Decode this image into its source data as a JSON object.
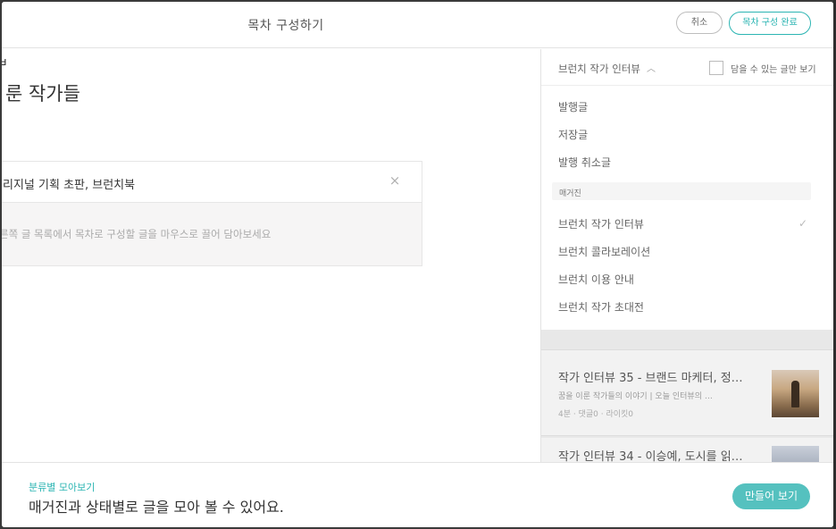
{
  "header": {
    "title": "목차 구성하기",
    "cancel_label": "취소",
    "done_label": "목차 구성 완료"
  },
  "left": {
    "stray_char": "ㅂ",
    "book_title": "룬 작가들",
    "toc_chapter": "리지널 기획 초판, 브런치북",
    "close_glyph": "×",
    "hint": "른쪽 글 목록에서 목차로 구성할 글을 마우스로 끌어 담아보세요"
  },
  "right": {
    "dropdown_label": "브런치 작가 인터뷰",
    "checkbox_label": "담을 수 있는 글만 보기",
    "menu_items": [
      "발행글",
      "저장글",
      "발행 취소글"
    ],
    "section_label": "매거진",
    "magazines": [
      "브런치 작가 인터뷰",
      "브런치 콜라보레이션",
      "브런치 이용 안내",
      "브런치 작가 초대전"
    ],
    "selected_magazine_index": 0,
    "articles": [
      {
        "title": "작가 인터뷰 35 - 브랜드 마케터, 정…",
        "subtitle": "꿈을 이룬 작가들의 이야기 | 오늘 인터뷰의 …",
        "meta": "4분 · 댓글0 · 라이킷0"
      },
      {
        "title": "작가 인터뷰 34 - 이승예, 도시를 읽…"
      }
    ]
  },
  "footer": {
    "small_label": "분류별 모아보기",
    "big_label": "매거진과 상태별로 글을 모아 볼 수 있어요.",
    "make_button": "만들어 보기"
  },
  "icons": {
    "chevron": "chevron-up-icon",
    "check": "check-icon",
    "close": "close-icon"
  },
  "colors": {
    "accent": "#2cb5b3",
    "accent_button": "#55c1bf"
  }
}
